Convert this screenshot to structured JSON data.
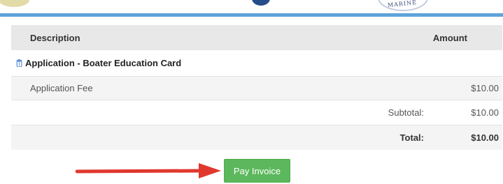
{
  "header": {
    "seal_text": "MARINE"
  },
  "table": {
    "columns": {
      "description": "Description",
      "amount": "Amount"
    },
    "section": {
      "title": "Application - Boater Education Card",
      "icon": "trash-icon"
    },
    "items": [
      {
        "description": "Application Fee",
        "amount": "$10.00"
      }
    ],
    "subtotal": {
      "label": "Subtotal:",
      "amount": "$10.00"
    },
    "total": {
      "label": "Total:",
      "amount": "$10.00"
    }
  },
  "actions": {
    "pay_label": "Pay Invoice"
  },
  "colors": {
    "accent_bar": "#5fa3d9",
    "pay_button": "#5cb85c",
    "arrow": "#e0382f",
    "section_icon": "#5b8fd4"
  }
}
